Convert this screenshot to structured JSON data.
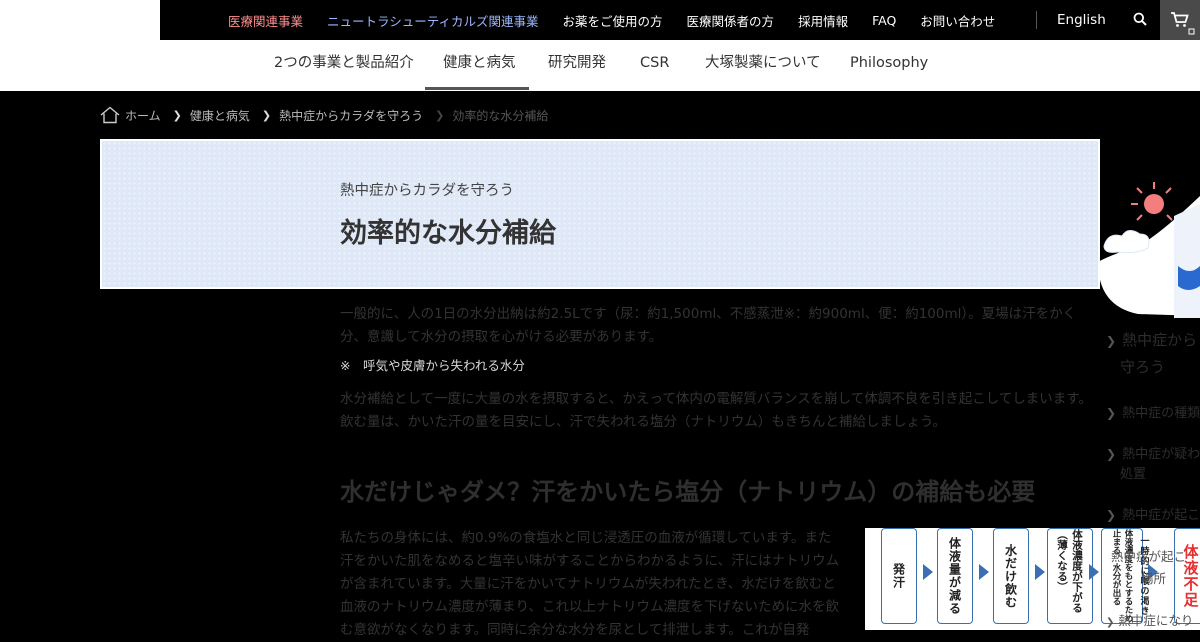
{
  "topnav": {
    "items": [
      {
        "label": "医療関連事業",
        "color": "#ff8f8f"
      },
      {
        "label": "ニュートラシューティカルズ関連事業",
        "color": "#9db8ff"
      },
      {
        "label": "お薬をご使用の方",
        "color": "#ffffff"
      },
      {
        "label": "医療関係者の方",
        "color": "#ffffff"
      },
      {
        "label": "採用情報",
        "color": "#ffffff"
      },
      {
        "label": "FAQ",
        "color": "#ffffff"
      },
      {
        "label": "お問い合わせ",
        "color": "#ffffff"
      }
    ],
    "english": "English"
  },
  "mainnav": {
    "items": [
      "2つの事業と製品紹介",
      "健康と病気",
      "研究開発",
      "CSR",
      "大塚製薬について",
      "Philosophy"
    ],
    "active": "健康と病気"
  },
  "breadcrumb": {
    "home": "ホーム",
    "items": [
      "健康と病気",
      "熱中症からカラダを守ろう"
    ],
    "current": "効率的な水分補給"
  },
  "hero": {
    "subtitle": "熱中症からカラダを守ろう",
    "title": "効率的な水分補給"
  },
  "content": {
    "p1": "一般的に、人の1日の水分出納は約2.5Lです（尿：約1,500ml、不感蒸泄※：約900ml、便：約100ml）。夏場は汗をかく分、意識して水分の摂取を心がける必要があります。",
    "note": "※　呼気や皮膚から失われる水分",
    "p2": "水分補給として一度に大量の水を摂取すると、かえって体内の電解質バランスを崩して体調不良を引き起こしてしまいます。飲む量は、かいた汗の量を目安にし、汗で失われる塩分（ナトリウム）もきちんと補給しましょう。",
    "h2": "水だけじゃダメ？汗をかいたら塩分（ナトリウム）の補給も必要",
    "p3": "私たちの身体には、約0.9%の食塩水と同じ浸透圧の血液が循環しています。また汗をかいた肌をなめると塩辛い味がすることからわかるように、汗にはナトリウムが含まれています。大量に汗をかいてナトリウムが失われたとき、水だけを飲むと血液のナトリウム濃度が薄まり、これ以上ナトリウム濃度を下げないために水を飲む意欲がなくなります。同時に余分な水分を尿として排泄します。これが自発"
  },
  "sidemenu": {
    "items": [
      "熱中症から",
      "守ろう",
      "熱中症の種類",
      "熱中症が疑わ",
      "処置",
      "熱中症が起こ"
    ]
  },
  "infographic": {
    "steps": [
      "発汗",
      "体液量が減る",
      "水だけ飲む",
      "体液濃度が下がる（薄くなる）",
      "体液濃度をもとするため止まる、水分が出る",
      "一時的に喉の渇き"
    ],
    "alert": "体液不足",
    "overlay": [
      "熱中症が起こ",
      "場所",
      "熱中症になり"
    ]
  }
}
